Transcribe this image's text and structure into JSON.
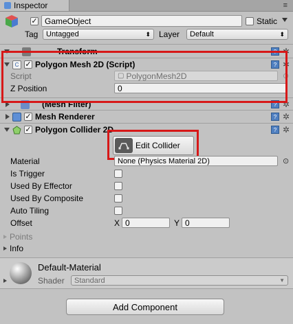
{
  "window": {
    "tab_title": "Inspector",
    "tab_menu_glyph": "≡",
    "tab_lock_glyph": "🔒"
  },
  "gameobject": {
    "active": true,
    "name": "GameObject",
    "static_label": "Static",
    "tag_label": "Tag",
    "tag_value": "Untagged",
    "layer_label": "Layer",
    "layer_value": "Default"
  },
  "components": {
    "transform": {
      "title": "Transform"
    },
    "polygon_mesh": {
      "title": "Polygon Mesh 2D (Script)",
      "enabled": true,
      "script_label": "Script",
      "script_value": "PolygonMesh2D",
      "zpos_label": "Z Position",
      "zpos_value": "0"
    },
    "mesh_filter": {
      "title": "(Mesh Filter)"
    },
    "mesh_renderer": {
      "title": "Mesh Renderer",
      "enabled": true
    },
    "polygon_collider": {
      "title": "Polygon Collider 2D",
      "enabled": true,
      "edit_collider_label": "Edit Collider",
      "material_label": "Material",
      "material_value": "None (Physics Material 2D)",
      "is_trigger_label": "Is Trigger",
      "used_by_effector_label": "Used By Effector",
      "used_by_composite_label": "Used By Composite",
      "auto_tiling_label": "Auto Tiling",
      "offset_label": "Offset",
      "offset_x_label": "X",
      "offset_x_value": "0",
      "offset_y_label": "Y",
      "offset_y_value": "0",
      "points_label": "Points",
      "info_label": "Info"
    }
  },
  "material": {
    "name": "Default-Material",
    "shader_label": "Shader",
    "shader_value": "Standard"
  },
  "add_component_label": "Add Component",
  "colors": {
    "highlight_red": "#d71818",
    "panel_bg": "#c2c2c2"
  }
}
